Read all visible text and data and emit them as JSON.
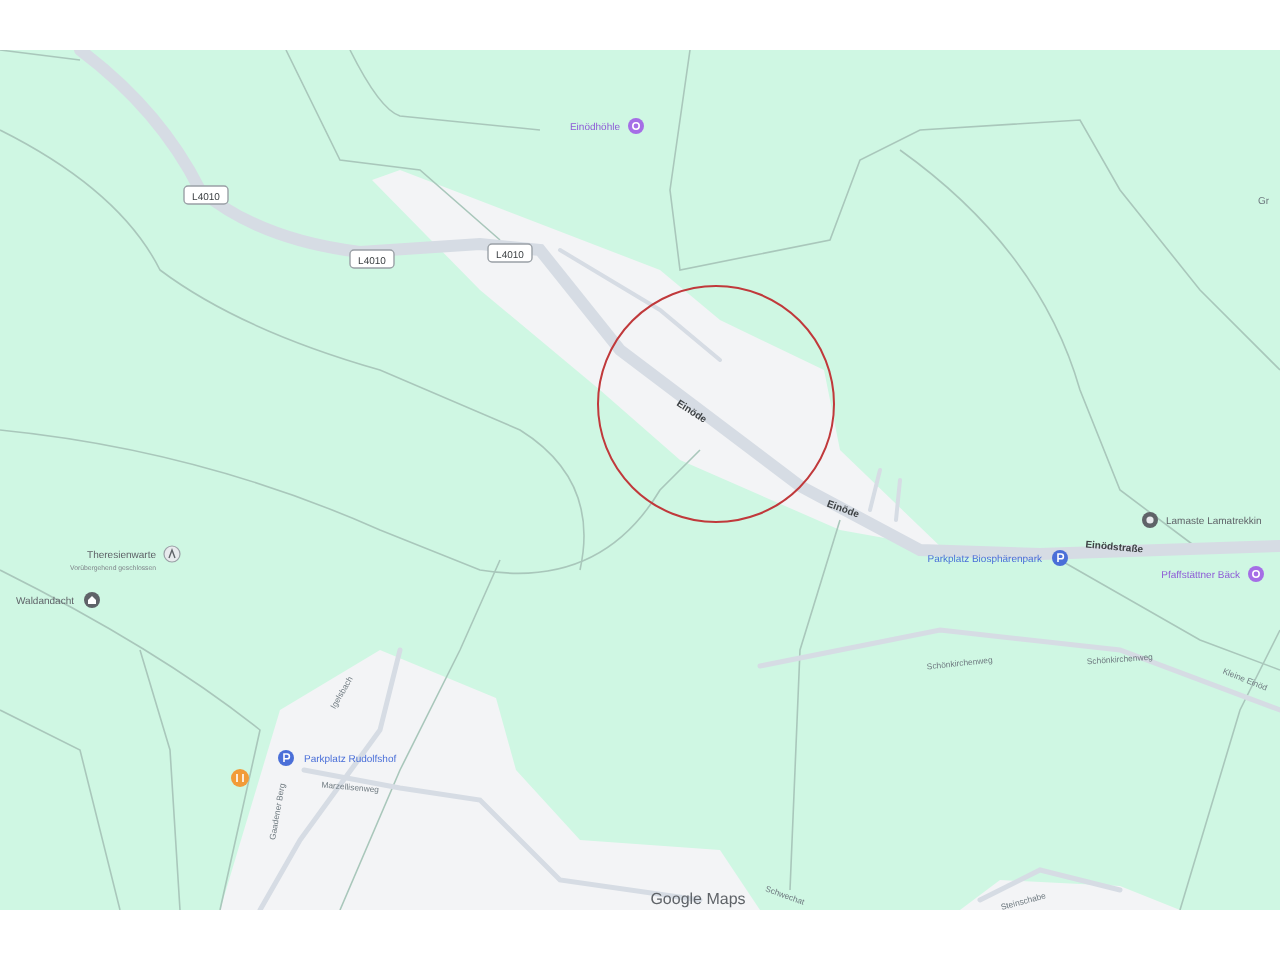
{
  "map": {
    "labels": [
      {
        "kind": "poi",
        "text": "Einödhöhle"
      },
      {
        "kind": "shield",
        "text": "L4010"
      },
      {
        "kind": "shield",
        "text": "L4010"
      },
      {
        "kind": "shield",
        "text": "L4010"
      },
      {
        "kind": "area",
        "text": "Gr"
      },
      {
        "kind": "road",
        "text": "Einöde"
      },
      {
        "kind": "road",
        "text": "Einöde"
      },
      {
        "kind": "place",
        "text": "Lamaste Lamatrekkin"
      },
      {
        "kind": "road",
        "text": "Einödstraße"
      },
      {
        "kind": "parking",
        "text": "Parkplatz Biosphärenpark"
      },
      {
        "kind": "poi",
        "text": "Pfaffstättner Bäck"
      },
      {
        "kind": "place",
        "text": "Theresienwarte"
      },
      {
        "kind": "note",
        "text": "Vorübergehend geschlossen"
      },
      {
        "kind": "place",
        "text": "Waldandacht"
      },
      {
        "kind": "path",
        "text": "Schönkirchenweg"
      },
      {
        "kind": "path",
        "text": "Schönkirchenweg"
      },
      {
        "kind": "path",
        "text": "Kleine Einöd"
      },
      {
        "kind": "path",
        "text": "Igelsbach"
      },
      {
        "kind": "parking",
        "text": "Parkplatz Rudolfshof"
      },
      {
        "kind": "path",
        "text": "Marzellisenweg"
      },
      {
        "kind": "path",
        "text": "Gaadener Berg"
      },
      {
        "kind": "path",
        "text": "Schwechat"
      },
      {
        "kind": "path",
        "text": "Steinschabe"
      }
    ],
    "attribution": "Google Maps"
  }
}
